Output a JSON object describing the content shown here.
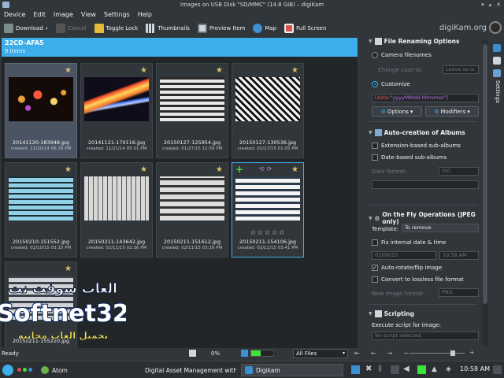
{
  "window": {
    "title": "Images on USB Disk \"SD/MMC\" (14.8 GiB) – digiKam",
    "brand": "digiKam.org"
  },
  "menu": [
    "Device",
    "Edit",
    "Image",
    "View",
    "Settings",
    "Help"
  ],
  "toolbar": {
    "download": "Download",
    "cancel": "Cancel",
    "toggle_lock": "Toggle Lock",
    "thumbnails": "Thumbnails",
    "preview": "Preview Item",
    "map": "Map",
    "fullscreen": "Full Screen"
  },
  "album": {
    "name": "22CD-AFA5",
    "count": "9 Items"
  },
  "items": [
    {
      "file": "20141120-183948.jpg",
      "created": "created: 11/20/14 06:39 PM",
      "state": "selected"
    },
    {
      "file": "20141121-170116.jpg",
      "created": "created: 11/21/14 05:01 PM",
      "state": ""
    },
    {
      "file": "20150127-125954.jpg",
      "created": "created: 01/27/15 12:59 PM",
      "state": ""
    },
    {
      "file": "20150127-130536.jpg",
      "created": "created: 01/27/15 01:05 PM",
      "state": ""
    },
    {
      "file": "20150210-151552.jpg",
      "created": "created: 02/10/15 03:15 PM",
      "state": ""
    },
    {
      "file": "20150211-143642.jpg",
      "created": "created: 02/11/15 02:36 PM",
      "state": ""
    },
    {
      "file": "20150211-151612.jpg",
      "created": "created: 02/11/15 03:16 PM",
      "state": ""
    },
    {
      "file": "20150211-154106.jpg",
      "created": "created: 02/11/15 03:41 PM",
      "state": "hover"
    },
    {
      "file": "20150211-155220.jpg",
      "created": "",
      "state": ""
    }
  ],
  "watermark": {
    "line1": "العاب سوفت نت",
    "line2": "Softnet32",
    "line3": "تحميل العاب مجانية"
  },
  "status": {
    "ready": "Ready",
    "pct_free": "0%",
    "pct_used": "43%",
    "used_fraction": 0.43,
    "filter": "All Files",
    "zoom_fraction": 0.82
  },
  "rename": {
    "header": "File Renaming Options",
    "camera_filenames": "Camera filenames",
    "change_case_to": "Change case to:",
    "leave_as_is": "Leave as-is",
    "customize": "Customize",
    "pattern_prefix": "[date:",
    "pattern_value": "\"yyyyMMdd-hhmmss\"]",
    "options": "Options",
    "modifiers": "Modifiers"
  },
  "albums": {
    "header": "Auto-creation of Albums",
    "ext_based": "Extension-based sub-albums",
    "date_based": "Date-based sub-albums",
    "date_format_label": "Date format:",
    "date_format": "ISO"
  },
  "onthefly": {
    "header": "On the Fly Operations (JPEG only)",
    "template_label": "Template:",
    "template_value": "To remove",
    "fix_date": "Fix internal date & time",
    "date": "03/09/15",
    "time": "10:58 AM",
    "auto_rotate": "Auto-rotate/flip image",
    "convert_lossless": "Convert to lossless file format",
    "new_format_label": "New image format:",
    "new_format": "PNG"
  },
  "scripting": {
    "header": "Scripting",
    "execute_label": "Execute script for image:",
    "no_script": "No script selected"
  },
  "sidetab": "Settings",
  "taskbar": {
    "atom": "Atom",
    "dam": "Digital Asset Management with",
    "digikam": "Digikam",
    "clock": "10:58 AM"
  },
  "colors": {
    "accent": "#3daee9",
    "background": "#31363b",
    "grid": "#232629",
    "star": "#d9c26b",
    "ok": "#3be33b"
  }
}
